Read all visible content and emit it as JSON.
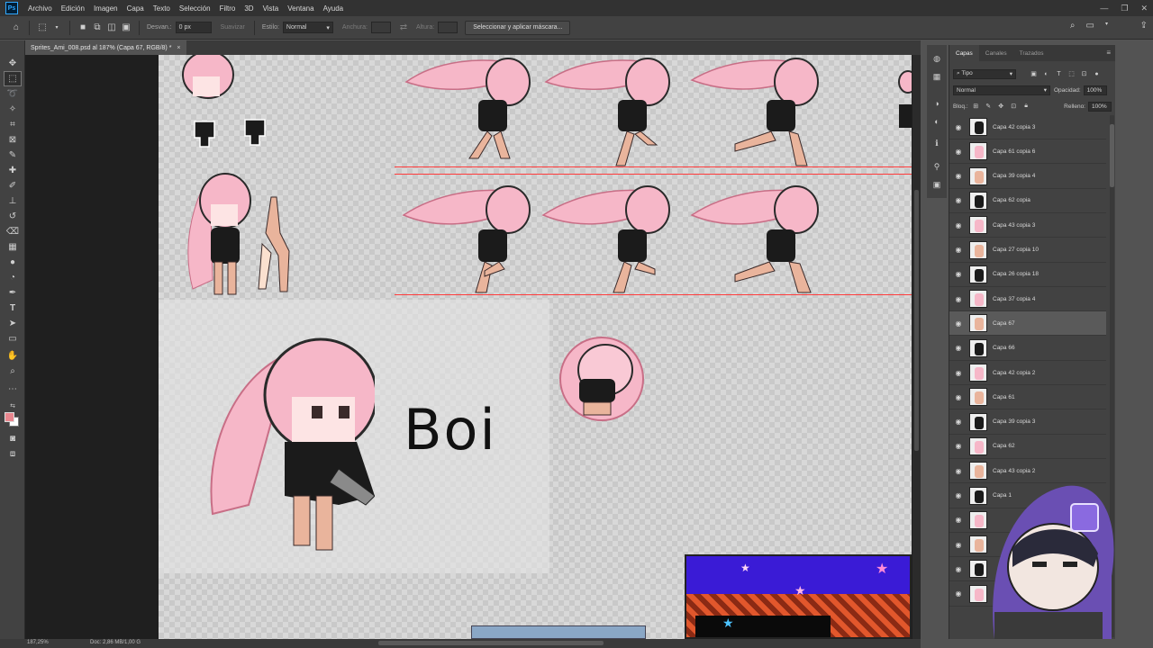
{
  "app": {
    "logo": "Ps"
  },
  "menu": [
    "Archivo",
    "Edición",
    "Imagen",
    "Capa",
    "Texto",
    "Selección",
    "Filtro",
    "3D",
    "Vista",
    "Ventana",
    "Ayuda"
  ],
  "window_controls": [
    "—",
    "❐",
    "✕"
  ],
  "options": {
    "feather_label": "Desvan.:",
    "feather_value": "0 px",
    "antialias_label": "Suavizar",
    "style_label": "Estilo:",
    "style_value": "Normal",
    "width_label": "Anchura:",
    "height_label": "Altura:",
    "select_mask_button": "Seleccionar y aplicar máscara..."
  },
  "document_tab": {
    "title": "Sprites_Ami_008.psd al 187% (Capa 67, RGB/8) *",
    "close": "×"
  },
  "canvas": {
    "text_label": "Boi"
  },
  "status": {
    "zoom": "187,25%",
    "doc_info": "Doc: 2,86 MB/1,00 G"
  },
  "layers_panel": {
    "tabs": [
      "Capas",
      "Canales",
      "Trazados"
    ],
    "filter_kind": "Tipo",
    "blend_mode": "Normal",
    "opacity_label": "Opacidad:",
    "opacity_value": "100%",
    "lock_label": "Bloq.:",
    "fill_label": "Relleno:",
    "fill_value": "100%",
    "layers": [
      {
        "name": "Capa 42 copia 3",
        "selected": false
      },
      {
        "name": "Capa 61 copia 6",
        "selected": false
      },
      {
        "name": "Capa 39 copia 4",
        "selected": false
      },
      {
        "name": "Capa 62 copia",
        "selected": false
      },
      {
        "name": "Capa 43 copia 3",
        "selected": false
      },
      {
        "name": "Capa 27 copia 10",
        "selected": false
      },
      {
        "name": "Capa 26 copia 18",
        "selected": false
      },
      {
        "name": "Capa 37 copia 4",
        "selected": false
      },
      {
        "name": "Capa 67",
        "selected": true
      },
      {
        "name": "Capa 66",
        "selected": false
      },
      {
        "name": "Capa 42 copia 2",
        "selected": false
      },
      {
        "name": "Capa 61",
        "selected": false
      },
      {
        "name": "Capa 39 copia 3",
        "selected": false
      },
      {
        "name": "Capa 62",
        "selected": false
      },
      {
        "name": "Capa 43 copia 2",
        "selected": false
      },
      {
        "name": "Capa 1",
        "selected": false
      },
      {
        "name": "",
        "selected": false
      },
      {
        "name": "",
        "selected": false
      },
      {
        "name": "",
        "selected": false
      },
      {
        "name": "",
        "selected": false
      }
    ]
  },
  "colors": {
    "foreground": "#e8868e",
    "background": "#ffffff",
    "guide": "#ff3b3b",
    "hair_pink": "#f6b7c8",
    "stream_purple": "#6a4fb3"
  }
}
